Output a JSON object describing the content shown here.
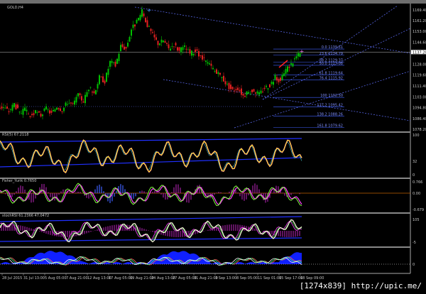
{
  "window": {
    "title": "GOLD,H4",
    "watermark": "[1274x839] http://upic.me/"
  },
  "chart_data": [
    {
      "type": "candlestick",
      "title": "GOLD,H4",
      "ylim": [
        1078.2,
        1169.4
      ],
      "y_ticks": [
        "1169.40",
        "1161.20",
        "1153.00",
        "1144.60",
        "1128.00",
        "1119.60",
        "1111.40",
        "1103.00",
        "1094.80",
        "1086.40",
        "1078.20"
      ],
      "current_price": "1137.20",
      "closes": [
        1095,
        1092,
        1098,
        1090,
        1093,
        1088,
        1091,
        1089,
        1094,
        1090,
        1096,
        1093,
        1099,
        1097,
        1104,
        1100,
        1110,
        1106,
        1118,
        1115,
        1130,
        1127,
        1142,
        1140,
        1155,
        1160,
        1168,
        1158,
        1150,
        1144,
        1146,
        1140,
        1143,
        1138,
        1141,
        1136,
        1138,
        1133,
        1130,
        1126,
        1121,
        1118,
        1112,
        1108,
        1110,
        1104,
        1106,
        1108,
        1105,
        1110,
        1112,
        1118,
        1115,
        1124,
        1128,
        1134,
        1137
      ],
      "fibonacci": [
        {
          "level": "0.0",
          "price": "1139.51"
        },
        {
          "level": "23.6",
          "price": "1134.79"
        },
        {
          "level": "38.2",
          "price": "1129.37"
        },
        {
          "level": "50.0",
          "price": "1127.08"
        },
        {
          "level": "61.8",
          "price": "1119.64"
        },
        {
          "level": "76.4",
          "price": "1115.92"
        },
        {
          "level": "100",
          "price": "1102.50"
        },
        {
          "level": "127.2",
          "price": "1095.42"
        },
        {
          "level": "138.2",
          "price": "1088.26"
        },
        {
          "level": "161.8",
          "price": "1079.62"
        }
      ],
      "colors": {
        "up": "#00c000",
        "down": "#e02020",
        "fib": "#4060ff",
        "channel": "#6070ff"
      }
    },
    {
      "type": "line",
      "title": "RSI(5) 67.2118",
      "ylim": [
        0,
        100
      ],
      "y_ticks": [
        "100",
        "32",
        "0"
      ],
      "colors": {
        "main": "#ffff00",
        "signal": "#ff40ff"
      }
    },
    {
      "type": "line",
      "title": "Fisher_Yurik 0.7650",
      "y_ticks": [
        "0.766",
        "0.00",
        "-0.679"
      ],
      "colors": {
        "main": "#80ff40",
        "signal": "#ff40ff",
        "hist": "#4060ff"
      }
    },
    {
      "type": "line",
      "title": "stochRSI 61.2366 47.0472",
      "y_ticks": [
        "105",
        "-5"
      ],
      "colors": {
        "main": "#ffffe0",
        "signal": "#ff40ff"
      }
    },
    {
      "type": "area",
      "title": "",
      "y_ticks": [
        "0"
      ],
      "colors": {
        "fill": "#1020ff"
      }
    }
  ],
  "x_ticks": [
    "28 Jul 2015",
    "31 Jul 13:00",
    "5 Aug 05:00",
    "7 Aug 21:00",
    "12 Aug 13:00",
    "17 Aug 05:00",
    "19 Aug 21:00",
    "24 Aug 13:00",
    "27 Aug 05:00",
    "31 Aug 21:00",
    "3 Sep 13:00",
    "8 Sep 05:00",
    "11 Sep 01:00",
    "15 Sep 17:00",
    "18 Sep 09:00"
  ]
}
